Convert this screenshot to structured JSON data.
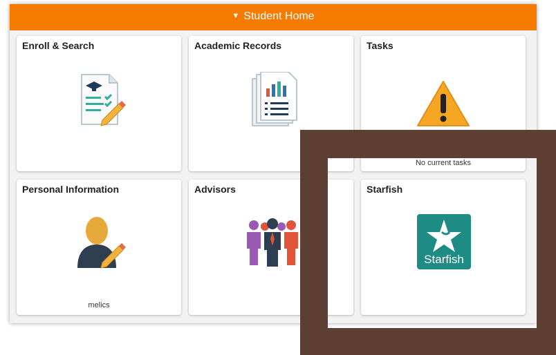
{
  "header": {
    "title": "Student Home",
    "toggle_icon": "triangle-down-icon"
  },
  "tiles": [
    {
      "title": "Enroll & Search",
      "icon": "enroll-search-icon"
    },
    {
      "title": "Academic Records",
      "icon": "academic-records-icon"
    },
    {
      "title": "Tasks",
      "icon": "warning-icon",
      "footer": "No current tasks"
    },
    {
      "title": "Personal Information",
      "icon": "person-edit-icon",
      "footer": "melics"
    },
    {
      "title": "Advisors",
      "icon": "advisors-group-icon"
    },
    {
      "title": "Starfish",
      "icon": "starfish-logo-icon",
      "logo_text": "Starfish"
    }
  ],
  "colors": {
    "header": "#f57c00",
    "overlay": "#5d3f34",
    "starfish": "#1e8b84"
  }
}
